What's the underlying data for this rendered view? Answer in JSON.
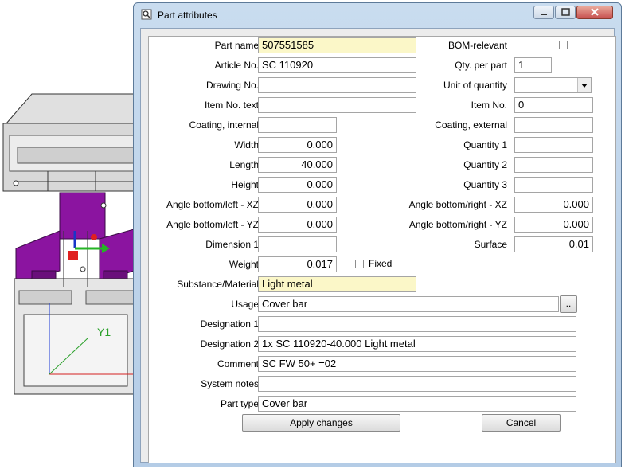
{
  "window": {
    "title": "Part attributes"
  },
  "fields": {
    "part_name": {
      "label": "Part name",
      "value": "507551585"
    },
    "article_no": {
      "label": "Article No.",
      "value": "SC 110920"
    },
    "drawing_no": {
      "label": "Drawing No.",
      "value": ""
    },
    "item_no_text": {
      "label": "Item No. text",
      "value": ""
    },
    "coating_internal": {
      "label": "Coating, internal",
      "value": ""
    },
    "width": {
      "label": "Width",
      "value": "0.000"
    },
    "length": {
      "label": "Length",
      "value": "40.000"
    },
    "height": {
      "label": "Height",
      "value": "0.000"
    },
    "angle_bl_xz": {
      "label": "Angle bottom/left - XZ",
      "value": "0.000"
    },
    "angle_bl_yz": {
      "label": "Angle bottom/left - YZ",
      "value": "0.000"
    },
    "dimension1": {
      "label": "Dimension 1",
      "value": ""
    },
    "weight": {
      "label": "Weight",
      "value": "0.017"
    },
    "fixed": {
      "label": "Fixed",
      "checked": false
    },
    "bom_relevant": {
      "label": "BOM-relevant",
      "checked": false
    },
    "qty_per_part": {
      "label": "Qty. per part",
      "value": "1"
    },
    "unit_of_quantity": {
      "label": "Unit of quantity",
      "value": ""
    },
    "item_no": {
      "label": "Item No.",
      "value": "0"
    },
    "coating_external": {
      "label": "Coating, external",
      "value": ""
    },
    "quantity1": {
      "label": "Quantity 1",
      "value": ""
    },
    "quantity2": {
      "label": "Quantity 2",
      "value": ""
    },
    "quantity3": {
      "label": "Quantity 3",
      "value": ""
    },
    "angle_br_xz": {
      "label": "Angle bottom/right - XZ",
      "value": "0.000"
    },
    "angle_br_yz": {
      "label": "Angle bottom/right - YZ",
      "value": "0.000"
    },
    "surface": {
      "label": "Surface",
      "value": "0.01"
    },
    "substance": {
      "label": "Substance/Material",
      "value": "Light metal"
    },
    "usage": {
      "label": "Usage",
      "value": "Cover bar",
      "browse": ".."
    },
    "designation1": {
      "label": "Designation 1",
      "value": ""
    },
    "designation2": {
      "label": "Designation 2",
      "value": "1x SC 110920-40.000 Light metal"
    },
    "comment": {
      "label": "Comment",
      "value": "SC FW 50+ =02"
    },
    "system_notes": {
      "label": "System notes",
      "value": ""
    },
    "part_type": {
      "label": "Part type",
      "value": "Cover bar"
    }
  },
  "buttons": {
    "apply": "Apply changes",
    "cancel": "Cancel"
  },
  "viewport": {
    "axis_label": "Y1"
  },
  "colors": {
    "highlight_field": "#fbf7c8",
    "purple_part": "#8b14a0",
    "arrow": "#e3211c"
  }
}
